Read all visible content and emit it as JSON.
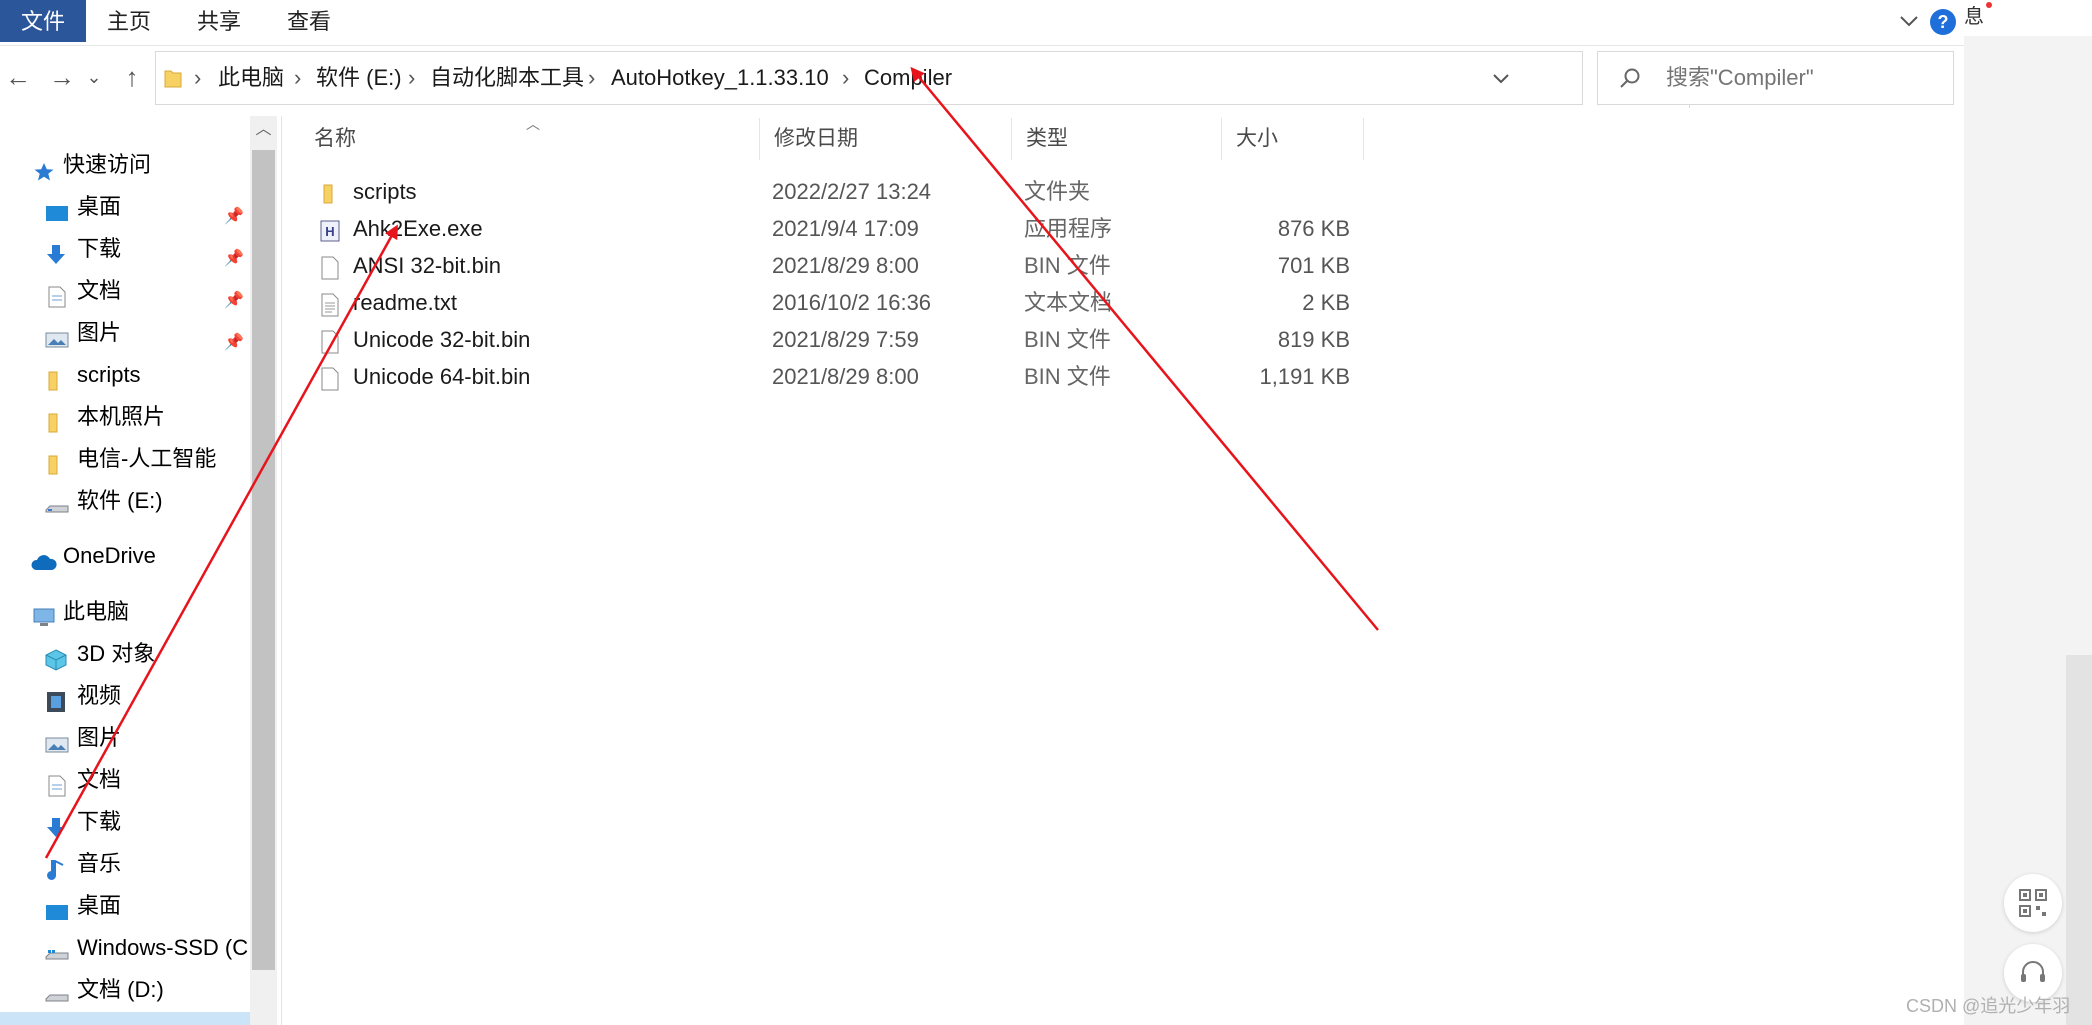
{
  "ribbon": {
    "tabs": [
      "文件",
      "主页",
      "共享",
      "查看"
    ],
    "right_partial_text": "息"
  },
  "nav": {
    "back": "←",
    "forward": "→",
    "recent": "⌄",
    "up": "↑"
  },
  "address": {
    "crumbs": [
      "此电脑",
      "软件 (E:)",
      "自动化脚本工具",
      "AutoHotkey_1.1.33.10",
      "Compiler"
    ],
    "separator": "›",
    "dropdown": "⌄",
    "refresh": "↻"
  },
  "search": {
    "placeholder": "搜索\"Compiler\""
  },
  "sidebar": {
    "quick_access": "快速访问",
    "items": [
      {
        "label": "桌面",
        "icon": "desktop-icon",
        "pinned": true
      },
      {
        "label": "下载",
        "icon": "download-icon",
        "pinned": true
      },
      {
        "label": "文档",
        "icon": "document-icon",
        "pinned": true
      },
      {
        "label": "图片",
        "icon": "picture-icon",
        "pinned": true
      },
      {
        "label": "scripts",
        "icon": "folder-icon",
        "pinned": false
      },
      {
        "label": "本机照片",
        "icon": "folder-icon",
        "pinned": false
      },
      {
        "label": "电信-人工智能",
        "icon": "folder-icon",
        "pinned": false
      },
      {
        "label": "软件 (E:)",
        "icon": "drive-icon",
        "pinned": false
      }
    ],
    "onedrive": "OneDrive",
    "this_pc": "此电脑",
    "pc_items": [
      {
        "label": "3D 对象",
        "icon": "3d-objects-icon"
      },
      {
        "label": "视频",
        "icon": "video-icon"
      },
      {
        "label": "图片",
        "icon": "picture-icon"
      },
      {
        "label": "文档",
        "icon": "document-icon"
      },
      {
        "label": "下载",
        "icon": "download-icon"
      },
      {
        "label": "音乐",
        "icon": "music-icon"
      },
      {
        "label": "桌面",
        "icon": "desktop-icon"
      },
      {
        "label": "Windows-SSD (C:",
        "icon": "drive-icon"
      },
      {
        "label": "文档 (D:)",
        "icon": "drive-icon"
      }
    ]
  },
  "columns": {
    "name": "名称",
    "date": "修改日期",
    "type": "类型",
    "size": "大小"
  },
  "files": [
    {
      "name": "scripts",
      "date": "2022/2/27 13:24",
      "type": "文件夹",
      "size": "",
      "icon": "folder-icon"
    },
    {
      "name": "Ahk2Exe.exe",
      "date": "2021/9/4 17:09",
      "type": "应用程序",
      "size": "876 KB",
      "icon": "ahk-exe-icon"
    },
    {
      "name": "ANSI 32-bit.bin",
      "date": "2021/8/29 8:00",
      "type": "BIN 文件",
      "size": "701 KB",
      "icon": "file-icon"
    },
    {
      "name": "readme.txt",
      "date": "2016/10/2 16:36",
      "type": "文本文档",
      "size": "2 KB",
      "icon": "text-file-icon"
    },
    {
      "name": "Unicode 32-bit.bin",
      "date": "2021/8/29 7:59",
      "type": "BIN 文件",
      "size": "819 KB",
      "icon": "file-icon"
    },
    {
      "name": "Unicode 64-bit.bin",
      "date": "2021/8/29 8:00",
      "type": "BIN 文件",
      "size": "1,191 KB",
      "icon": "file-icon"
    }
  ],
  "watermark": "CSDN @追光少年羽",
  "colors": {
    "file_tab": "#2b579a",
    "annotation_arrow": "#e8141b",
    "help_button": "#1e6fd9"
  }
}
